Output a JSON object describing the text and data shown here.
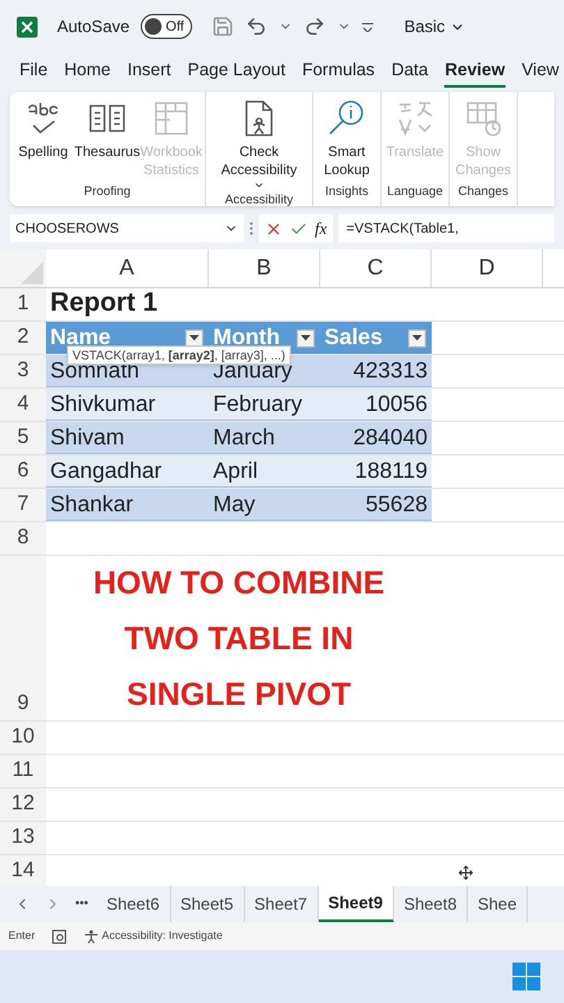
{
  "title_bar": {
    "autosave_label": "AutoSave",
    "autosave": {
      "on": false,
      "label": "Off"
    },
    "style_menu": "Basic"
  },
  "menu_tabs": [
    {
      "label": "File",
      "selected": false
    },
    {
      "label": "Home",
      "selected": false
    },
    {
      "label": "Insert",
      "selected": false
    },
    {
      "label": "Page Layout",
      "selected": false
    },
    {
      "label": "Formulas",
      "selected": false
    },
    {
      "label": "Data",
      "selected": false
    },
    {
      "label": "Review",
      "selected": true
    },
    {
      "label": "View",
      "selected": false
    }
  ],
  "ribbon_groups": [
    {
      "label": "Proofing",
      "items": [
        {
          "label": "Spelling",
          "disabled": false
        },
        {
          "label": "Thesaurus",
          "disabled": false
        },
        {
          "label": "Workbook Statistics",
          "disabled": true
        }
      ]
    },
    {
      "label": "Accessibility",
      "items": [
        {
          "label": "Check Accessibility",
          "disabled": false,
          "dropdown": true
        }
      ]
    },
    {
      "label": "Insights",
      "items": [
        {
          "label": "Smart Lookup",
          "disabled": false
        }
      ]
    },
    {
      "label": "Language",
      "items": [
        {
          "label": "Translate",
          "disabled": true
        }
      ]
    },
    {
      "label": "Changes",
      "items": [
        {
          "label": "Show Changes",
          "disabled": true
        }
      ]
    }
  ],
  "formula_bar": {
    "name_box": "CHOOSEROWS",
    "function_label": "fx",
    "formula": "=VSTACK(Table1,"
  },
  "sheet": {
    "columns": [
      "A",
      "B",
      "C",
      "D"
    ],
    "rows": [
      {
        "number": "1",
        "kind": "title",
        "cells": [
          "Report 1"
        ]
      },
      {
        "number": "2",
        "kind": "header",
        "cells": [
          "Name",
          "Month",
          "Sales"
        ]
      },
      {
        "number": "3",
        "kind": "data",
        "cells": [
          "Somnath",
          "January",
          "423313"
        ]
      },
      {
        "number": "4",
        "kind": "data",
        "cells": [
          "Shivkumar",
          "February",
          "10056"
        ]
      },
      {
        "number": "5",
        "kind": "data",
        "cells": [
          "Shivam",
          "March",
          "284040"
        ]
      },
      {
        "number": "6",
        "kind": "data",
        "cells": [
          "Gangadhar",
          "April",
          "188119"
        ]
      },
      {
        "number": "7",
        "kind": "data",
        "cells": [
          "Shankar",
          "May",
          "55628"
        ]
      },
      {
        "number": "8",
        "kind": "empty"
      },
      {
        "number": "9",
        "kind": "caption",
        "text": "HOW TO COMBINE TWO TABLE IN SINGLE PIVOT"
      },
      {
        "number": "10",
        "kind": "empty"
      },
      {
        "number": "11",
        "kind": "empty"
      },
      {
        "number": "12",
        "kind": "empty"
      },
      {
        "number": "13",
        "kind": "empty"
      },
      {
        "number": "14",
        "kind": "empty"
      }
    ],
    "tooltip": "VSTACK(array1, **[array2]**, [array3], ...)"
  },
  "sheet_tabs": [
    {
      "label": "Sheet6",
      "selected": false
    },
    {
      "label": "Sheet5",
      "selected": false
    },
    {
      "label": "Sheet7",
      "selected": false
    },
    {
      "label": "Sheet9",
      "selected": true
    },
    {
      "label": "Sheet8",
      "selected": false
    },
    {
      "label": "Shee",
      "selected": false
    }
  ],
  "more_sheets": "•••",
  "status_bar": {
    "mode": "Enter",
    "accessibility": "Accessibility: Investigate"
  }
}
